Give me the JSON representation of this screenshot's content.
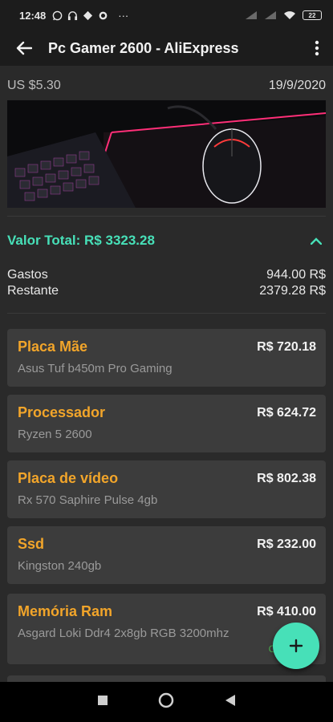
{
  "status_bar": {
    "time": "12:48",
    "dots": "···",
    "battery": "22"
  },
  "app_bar": {
    "title": "Pc Gamer 2600 - AliExpress"
  },
  "meta": {
    "price": "US $5.30",
    "date": "19/9/2020"
  },
  "total": {
    "label": "Valor Total: R$ 3323.28"
  },
  "summary": {
    "spent_label": "Gastos",
    "spent_value": "944.00 R$",
    "remaining_label": "Restante",
    "remaining_value": "2379.28 R$"
  },
  "items": [
    {
      "name": "Placa Mãe",
      "detail": "Asus Tuf b450m Pro Gaming",
      "price": "R$ 720.18"
    },
    {
      "name": "Processador",
      "detail": "Ryzen 5 2600",
      "price": "R$ 624.72"
    },
    {
      "name": "Placa de vídeo",
      "detail": "Rx 570 Saphire Pulse 4gb",
      "price": "R$ 802.38"
    },
    {
      "name": "Ssd",
      "detail": "Kingston 240gb",
      "price": "R$ 232.00"
    },
    {
      "name": "Memória Ram",
      "detail": "Asgard Loki Ddr4 2x8gb RGB 3200mhz",
      "price": "R$ 410.00",
      "status": "Co"
    }
  ],
  "colors": {
    "accent": "#47e0b8",
    "item_title": "#f2a52a",
    "status_green": "#4caf50",
    "card_bg": "#3c3c3c"
  },
  "icons": {
    "back": "arrow-back-icon",
    "menu": "more-vert-icon",
    "collapse": "chevron-up-icon",
    "fab": "plus-icon"
  }
}
